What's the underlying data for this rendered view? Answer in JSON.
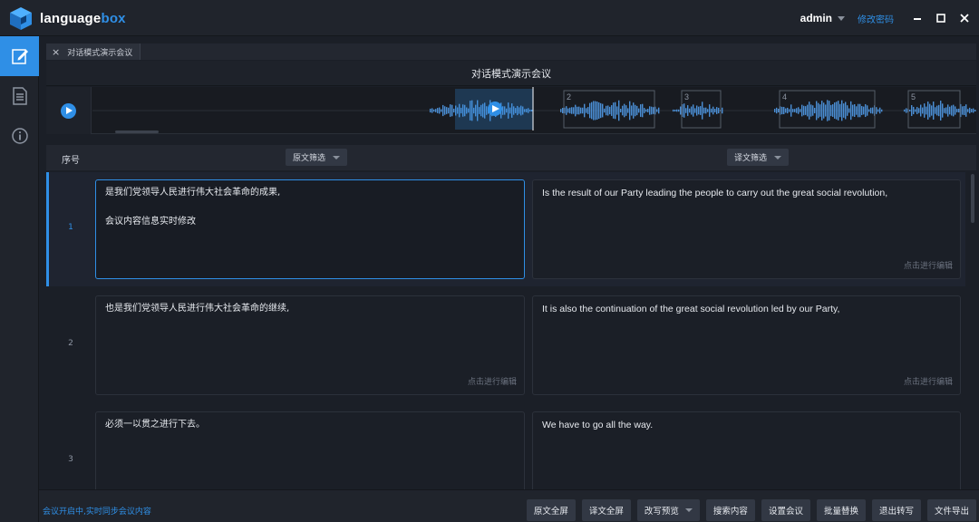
{
  "app": {
    "logo_word1": "language",
    "logo_word2": "box",
    "user": "admin",
    "change_password": "修改密码"
  },
  "colors": {
    "accent": "#2f8fe6",
    "background": "#1b1f27",
    "panel": "#20242c",
    "button": "#323844"
  },
  "sidebar": {
    "items": [
      {
        "icon": "edit-icon",
        "active": true
      },
      {
        "icon": "document-icon",
        "active": false
      },
      {
        "icon": "info-icon",
        "active": false
      }
    ]
  },
  "tabs": [
    {
      "label": "对话模式演示会议",
      "close": "×"
    }
  ],
  "meeting_title": "对话模式演示会议",
  "waveform": {
    "segments": [
      {
        "label": "2"
      },
      {
        "label": "3"
      },
      {
        "label": "4"
      },
      {
        "label": "5"
      }
    ]
  },
  "columns": {
    "seq": "序号",
    "source_filter": "原文筛选",
    "target_filter": "译文筛选"
  },
  "rows": [
    {
      "num": "1",
      "source": "是我们党领导人民进行伟大社会革命的成果,",
      "source_extra": "会议内容信息实时修改",
      "source_hint": "",
      "target": "Is the result of our Party leading the people to carry out the great social revolution,",
      "target_hint": "点击进行编辑"
    },
    {
      "num": "2",
      "source": "也是我们党领导人民进行伟大社会革命的继续,",
      "source_extra": "",
      "source_hint": "点击进行编辑",
      "target": "It is also the continuation of the great social revolution led by our Party,",
      "target_hint": "点击进行编辑"
    },
    {
      "num": "3",
      "source": "必须一以贯之进行下去。",
      "source_extra": "",
      "source_hint": "",
      "target": "We have to go all the way.",
      "target_hint": ""
    }
  ],
  "footer": {
    "status": "会议开启中,实时同步会议内容",
    "buttons": [
      "原文全屏",
      "译文全屏",
      "改写预览",
      "搜索内容",
      "设置会议",
      "批量替换",
      "退出转写",
      "文件导出"
    ]
  }
}
